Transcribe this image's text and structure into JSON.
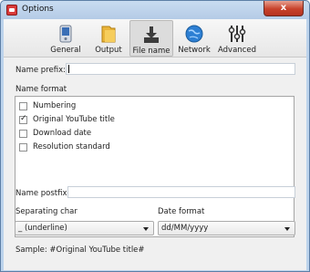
{
  "window": {
    "title": "Options",
    "close_symbol": "x"
  },
  "toolbar": {
    "tabs": [
      {
        "label": "General",
        "icon": "device-icon"
      },
      {
        "label": "Output",
        "icon": "folder-icon"
      },
      {
        "label": "File name",
        "icon": "download-icon",
        "active": true
      },
      {
        "label": "Network",
        "icon": "globe-icon"
      },
      {
        "label": "Advanced",
        "icon": "sliders-icon"
      }
    ]
  },
  "form": {
    "name_prefix_label": "Name prefix:",
    "name_prefix_value": "",
    "name_format_label": "Name format",
    "name_format_options": [
      {
        "label": "Numbering",
        "checked": false
      },
      {
        "label": "Original YouTube title",
        "checked": true
      },
      {
        "label": "Download date",
        "checked": false
      },
      {
        "label": "Resolution standard",
        "checked": false
      }
    ],
    "name_postfix_label": "Name postfix:",
    "name_postfix_value": "",
    "separating_char_label": "Separating char",
    "separating_char_value": "_ (underline)",
    "date_format_label": "Date format",
    "date_format_value": "dd/MM/yyyy",
    "sample_text": "Sample: #Original YouTube title#"
  }
}
